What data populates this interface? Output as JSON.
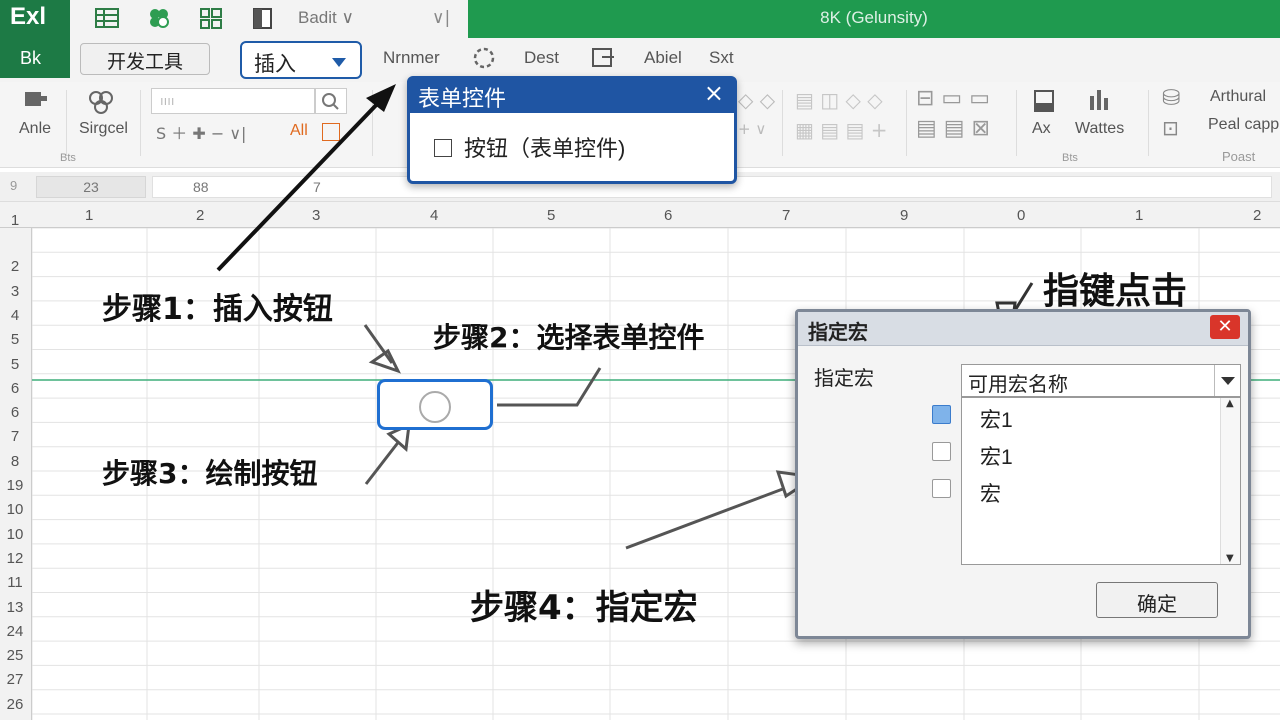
{
  "titlebar": {
    "app_logo": "Exl",
    "font_box": "Badit",
    "doc_title": "8K (Gelunsity)"
  },
  "tabs": {
    "bk": "Bk",
    "developer": "开发工具",
    "insert": "插入",
    "others": [
      "Nrnmer",
      "Dest",
      "Abiel",
      "Sxt"
    ]
  },
  "ribbon": {
    "anle": "Anle",
    "sirgcel": "Sirgcel",
    "all": "All",
    "group1": "Bts",
    "ax": "Ax",
    "wattes": "Wattes",
    "group2": "Bts",
    "arthural": "Arthural",
    "peal_capp": "Peal capp",
    "group3": "Poast",
    "search_value": "ıııı"
  },
  "formula": {
    "namebox": "23",
    "value": "88",
    "tail": "7"
  },
  "grid": {
    "row_corner": "9",
    "columns": [
      "1",
      "2",
      "3",
      "4",
      "5",
      "6",
      "7",
      "9",
      "0",
      "1",
      "2"
    ],
    "rows": [
      "1",
      "2",
      "3",
      "4",
      "5",
      "5",
      "6",
      "6",
      "7",
      "8",
      "19",
      "10",
      "10",
      "12",
      "11",
      "13",
      "24",
      "25",
      "27",
      "26"
    ]
  },
  "form_popup": {
    "title": "表单控件",
    "close": "×",
    "option": "按钮（表单控件)"
  },
  "steps": {
    "step1": "步骤1：插入按钮",
    "step2": "步骤2：选择表单控件",
    "step3": "步骤3：绘制按钮",
    "step4": "步骤4：指定宏",
    "pointer_hint": "指键点击"
  },
  "macro_dialog": {
    "title": "指定宏",
    "close": "✕",
    "label": "指定宏",
    "select_placeholder": "可用宏名称",
    "items": [
      "宏1",
      "宏1",
      "宏"
    ],
    "checked": [
      true,
      false,
      false
    ],
    "ok": "确定"
  },
  "colors": {
    "excel_green": "#1d7a45",
    "title_green": "#1f9a4f",
    "accent_blue": "#1f55a3",
    "close_red": "#d9352a"
  }
}
